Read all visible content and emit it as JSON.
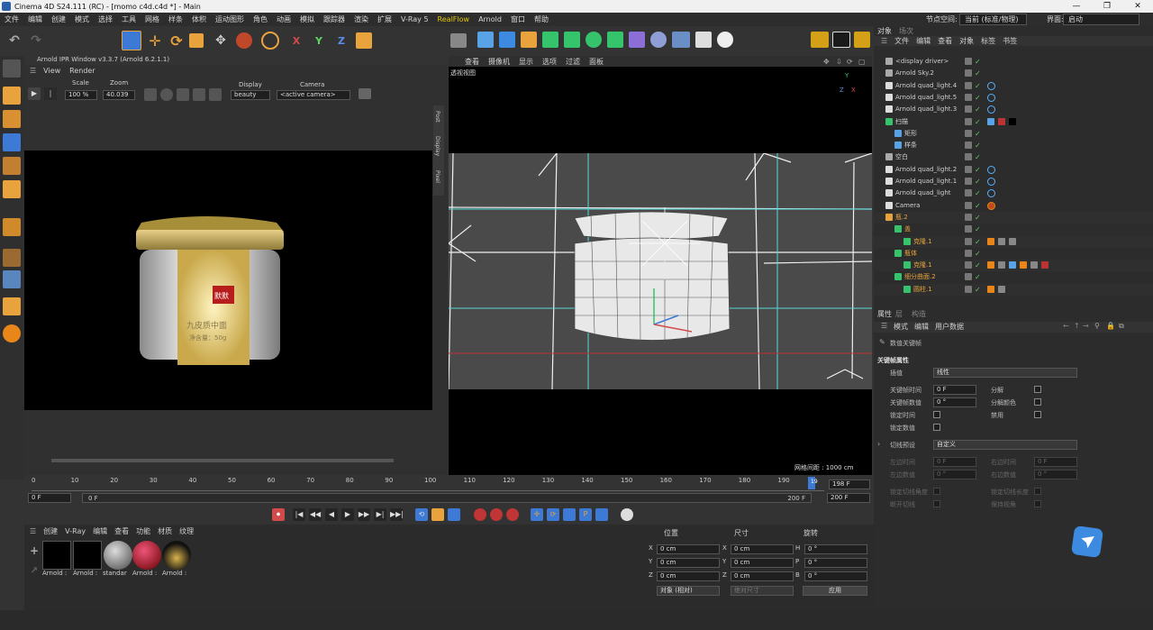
{
  "window": {
    "title": "Cinema 4D S24.111 (RC) - [momo c4d.c4d *] - Main",
    "minimize": "—",
    "maximize": "❐",
    "close": "✕"
  },
  "menu": [
    "文件",
    "编辑",
    "创建",
    "模式",
    "选择",
    "工具",
    "网格",
    "样条",
    "体积",
    "运动图形",
    "角色",
    "动画",
    "模拟",
    "跟踪器",
    "渲染",
    "扩展",
    "V-Ray 5",
    "RealFlow",
    "Arnold",
    "窗口",
    "帮助"
  ],
  "header_right": {
    "node_space_label": "节点空间:",
    "node_space_value": "当前 (标准/物理)",
    "layout_label": "界面:",
    "layout_value": "启动"
  },
  "axes": {
    "x": "X",
    "y": "Y",
    "z": "Z"
  },
  "ipr": {
    "title": "Arnold IPR Window v3.3.7 (Arnold 6.2.1.1)",
    "menu": [
      "View",
      "Render"
    ],
    "scale_label": "Scale",
    "scale_value": "100 %",
    "zoom_label": "Zoom",
    "zoom_value": "40.039",
    "display_label": "Display",
    "display_value": "beauty",
    "camera_label": "Camera",
    "camera_value": "<active camera>",
    "side_tabs": [
      "Post",
      "Display",
      "Pixel"
    ],
    "product_brand": "默默",
    "product_line1": "九皮质中面",
    "product_line2": "净含量：50g"
  },
  "viewport": {
    "menu": [
      "查看",
      "摄像机",
      "显示",
      "选项",
      "过滤",
      "面板"
    ],
    "label": "透视视图",
    "grid_info": "网格间距 : 1000 cm",
    "nav_icons": [
      "✥",
      "⇩",
      "⟳",
      "▢"
    ]
  },
  "objects": {
    "tabs": [
      "对象",
      "场次"
    ],
    "menu": [
      "文件",
      "编辑",
      "查看",
      "对象",
      "标签",
      "书签"
    ],
    "rows": [
      {
        "name": "<display driver>",
        "indent": 0,
        "color": "#cfcfcf"
      },
      {
        "name": "Arnold Sky.2",
        "indent": 0,
        "color": "#cfcfcf"
      },
      {
        "name": "Arnold quad_light.4",
        "indent": 0,
        "color": "#cfcfcf"
      },
      {
        "name": "Arnold quad_light.5",
        "indent": 0,
        "color": "#cfcfcf"
      },
      {
        "name": "Arnold quad_light.3",
        "indent": 0,
        "color": "#cfcfcf"
      },
      {
        "name": "扫描",
        "indent": 0,
        "color": "#cfcfcf"
      },
      {
        "name": "矩形",
        "indent": 1,
        "color": "#cfcfcf"
      },
      {
        "name": "样条",
        "indent": 1,
        "color": "#cfcfcf"
      },
      {
        "name": "空白",
        "indent": 0,
        "color": "#cfcfcf"
      },
      {
        "name": "Arnold quad_light.2",
        "indent": 0,
        "color": "#cfcfcf"
      },
      {
        "name": "Arnold quad_light.1",
        "indent": 0,
        "color": "#cfcfcf"
      },
      {
        "name": "Arnold quad_light",
        "indent": 0,
        "color": "#cfcfcf"
      },
      {
        "name": "Camera",
        "indent": 0,
        "color": "#cfcfcf"
      },
      {
        "name": "瓶.2",
        "indent": 0,
        "color": "#e8a33c"
      },
      {
        "name": "盖",
        "indent": 1,
        "color": "#e8a33c"
      },
      {
        "name": "克隆.1",
        "indent": 2,
        "color": "#e8a33c"
      },
      {
        "name": "瓶体",
        "indent": 1,
        "color": "#e8a33c"
      },
      {
        "name": "克隆.1",
        "indent": 2,
        "color": "#e8a33c"
      },
      {
        "name": "细分曲面.2",
        "indent": 1,
        "color": "#e8a33c"
      },
      {
        "name": "圆柱.1",
        "indent": 2,
        "color": "#e8a33c"
      }
    ]
  },
  "attributes": {
    "tabs": [
      "属性",
      "层",
      "构造"
    ],
    "menu": [
      "模式",
      "编辑",
      "用户数据"
    ],
    "title": "数值关键帧",
    "section": "关键帧属性",
    "interp_label": "插值",
    "interp_value": "线性",
    "key_time_label": "关键帧时间",
    "key_time_value": "0 F",
    "key_value_label": "关键帧数值",
    "key_value_value": "0 °",
    "lock_time_label": "锁定时间",
    "lock_value_label": "锁定数值",
    "break_label": "分解",
    "break_color_label": "分解颜色",
    "mute_label": "禁用",
    "preset_label": "切线预设",
    "preset_value": "自定义",
    "left_time_label": "左边时间",
    "left_time_value": "0 F",
    "right_time_label": "右边时间",
    "right_time_value": "0 F",
    "left_value_label": "左边数值",
    "left_value_value": "0 °",
    "right_value_label": "右边数值",
    "right_value_value": "0 °",
    "lock_angle_label": "锁定切线角度",
    "lock_length_label": "锁定切线长度",
    "break_tangent_label": "断开切线",
    "keep_zero_label": "保持视角"
  },
  "timeline": {
    "ticks": [
      "0",
      "10",
      "20",
      "30",
      "40",
      "50",
      "60",
      "70",
      "80",
      "90",
      "100",
      "110",
      "120",
      "130",
      "140",
      "150",
      "160",
      "170",
      "180",
      "190"
    ],
    "current": "198 F",
    "start": "0 F",
    "start2": "0 F",
    "end": "200 F",
    "end2": "200 F",
    "marker": "19"
  },
  "playback": [
    "⏺",
    "|◀",
    "◀◀",
    "◀",
    "▶",
    "▶▶",
    "▶|",
    "▶▶|"
  ],
  "materials": {
    "menu": [
      "创建",
      "V-Ray",
      "编辑",
      "查看",
      "功能",
      "材质",
      "纹理"
    ],
    "items": [
      "Arnold :",
      "Arnold :",
      "standar",
      "Arnold :",
      "Arnold :"
    ]
  },
  "coords": {
    "headers": [
      "位置",
      "尺寸",
      "旋转"
    ],
    "rows": [
      {
        "axis": "X",
        "pos": "0 cm",
        "size": "0 cm",
        "rot_axis": "H",
        "rot": "0 °"
      },
      {
        "axis": "Y",
        "pos": "0 cm",
        "size": "0 cm",
        "rot_axis": "P",
        "rot": "0 °"
      },
      {
        "axis": "Z",
        "pos": "0 cm",
        "size": "0 cm",
        "rot_axis": "B",
        "rot": "0 °"
      }
    ],
    "mode": "对象 (相对)",
    "size_mode": "绝对尺寸",
    "apply": "应用"
  },
  "colors": {
    "accent": "#3d7ad6",
    "orange": "#e8a33c",
    "green": "#5fd35f",
    "realflow": "#e2c400"
  }
}
